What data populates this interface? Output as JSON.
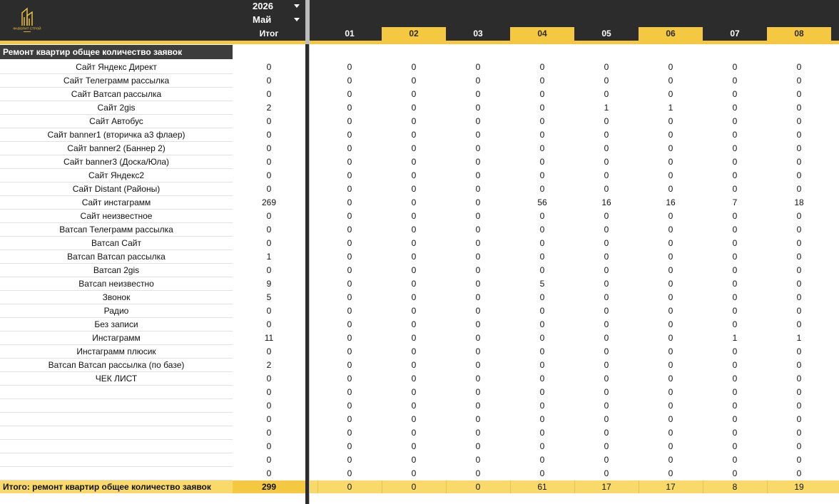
{
  "brand": {
    "logo_icon": "building-logo-icon",
    "logo_text": "ФАВОРИТ СТРОЙ",
    "accent": "#f5c842",
    "dark": "#2c2c2c"
  },
  "filters": {
    "year": "2026",
    "month": "Май"
  },
  "header": {
    "total_label": "Итог"
  },
  "days": [
    "01",
    "02",
    "03",
    "04",
    "05",
    "06",
    "07",
    "08"
  ],
  "section_title": "Ремонт квартир общее количество заявок",
  "rows": [
    {
      "label": "Сайт Яндекс Директ",
      "total": "0",
      "values": [
        "0",
        "0",
        "0",
        "0",
        "0",
        "0",
        "0",
        "0"
      ]
    },
    {
      "label": "Сайт Телеграмм рассылка",
      "total": "0",
      "values": [
        "0",
        "0",
        "0",
        "0",
        "0",
        "0",
        "0",
        "0"
      ]
    },
    {
      "label": "Сайт Ватсап рассылка",
      "total": "0",
      "values": [
        "0",
        "0",
        "0",
        "0",
        "0",
        "0",
        "0",
        "0"
      ]
    },
    {
      "label": "Сайт 2gis",
      "total": "2",
      "values": [
        "0",
        "0",
        "0",
        "0",
        "1",
        "1",
        "0",
        "0"
      ]
    },
    {
      "label": "Сайт Автобус",
      "total": "0",
      "values": [
        "0",
        "0",
        "0",
        "0",
        "0",
        "0",
        "0",
        "0"
      ]
    },
    {
      "label": "Сайт banner1 (вторичка а3 флаер)",
      "total": "0",
      "values": [
        "0",
        "0",
        "0",
        "0",
        "0",
        "0",
        "0",
        "0"
      ]
    },
    {
      "label": "Сайт banner2 (Баннер 2)",
      "total": "0",
      "values": [
        "0",
        "0",
        "0",
        "0",
        "0",
        "0",
        "0",
        "0"
      ]
    },
    {
      "label": "Сайт banner3 (Доска/Юла)",
      "total": "0",
      "values": [
        "0",
        "0",
        "0",
        "0",
        "0",
        "0",
        "0",
        "0"
      ]
    },
    {
      "label": "Сайт Яндекс2",
      "total": "0",
      "values": [
        "0",
        "0",
        "0",
        "0",
        "0",
        "0",
        "0",
        "0"
      ]
    },
    {
      "label": "Сайт Distant (Районы)",
      "total": "0",
      "values": [
        "0",
        "0",
        "0",
        "0",
        "0",
        "0",
        "0",
        "0"
      ]
    },
    {
      "label": "Сайт инстаграмм",
      "total": "269",
      "values": [
        "0",
        "0",
        "0",
        "56",
        "16",
        "16",
        "7",
        "18"
      ]
    },
    {
      "label": "Сайт неизвестное",
      "total": "0",
      "values": [
        "0",
        "0",
        "0",
        "0",
        "0",
        "0",
        "0",
        "0"
      ]
    },
    {
      "label": "Ватсап Телеграмм рассылка",
      "total": "0",
      "values": [
        "0",
        "0",
        "0",
        "0",
        "0",
        "0",
        "0",
        "0"
      ]
    },
    {
      "label": "Ватсап Сайт",
      "total": "0",
      "values": [
        "0",
        "0",
        "0",
        "0",
        "0",
        "0",
        "0",
        "0"
      ]
    },
    {
      "label": "Ватсап Ватсап рассылка",
      "total": "1",
      "values": [
        "0",
        "0",
        "0",
        "0",
        "0",
        "0",
        "0",
        "0"
      ]
    },
    {
      "label": "Ватсап 2gis",
      "total": "0",
      "values": [
        "0",
        "0",
        "0",
        "0",
        "0",
        "0",
        "0",
        "0"
      ]
    },
    {
      "label": "Ватсап неизвестно",
      "total": "9",
      "values": [
        "0",
        "0",
        "0",
        "5",
        "0",
        "0",
        "0",
        "0"
      ]
    },
    {
      "label": "Звонок",
      "total": "5",
      "values": [
        "0",
        "0",
        "0",
        "0",
        "0",
        "0",
        "0",
        "0"
      ]
    },
    {
      "label": "Радио",
      "total": "0",
      "values": [
        "0",
        "0",
        "0",
        "0",
        "0",
        "0",
        "0",
        "0"
      ]
    },
    {
      "label": "Без записи",
      "total": "0",
      "values": [
        "0",
        "0",
        "0",
        "0",
        "0",
        "0",
        "0",
        "0"
      ]
    },
    {
      "label": "Инстаграмм",
      "total": "11",
      "values": [
        "0",
        "0",
        "0",
        "0",
        "0",
        "0",
        "1",
        "1"
      ]
    },
    {
      "label": "Инстаграмм плюсик",
      "total": "0",
      "values": [
        "0",
        "0",
        "0",
        "0",
        "0",
        "0",
        "0",
        "0"
      ]
    },
    {
      "label": "Ватсап Ватсап рассылка (по базе)",
      "total": "2",
      "values": [
        "0",
        "0",
        "0",
        "0",
        "0",
        "0",
        "0",
        "0"
      ]
    },
    {
      "label": "ЧЕК ЛИСТ",
      "total": "0",
      "values": [
        "0",
        "0",
        "0",
        "0",
        "0",
        "0",
        "0",
        "0"
      ]
    },
    {
      "label": "",
      "total": "0",
      "values": [
        "0",
        "0",
        "0",
        "0",
        "0",
        "0",
        "0",
        "0"
      ]
    },
    {
      "label": "",
      "total": "0",
      "values": [
        "0",
        "0",
        "0",
        "0",
        "0",
        "0",
        "0",
        "0"
      ]
    },
    {
      "label": "",
      "total": "0",
      "values": [
        "0",
        "0",
        "0",
        "0",
        "0",
        "0",
        "0",
        "0"
      ]
    },
    {
      "label": "",
      "total": "0",
      "values": [
        "0",
        "0",
        "0",
        "0",
        "0",
        "0",
        "0",
        "0"
      ]
    },
    {
      "label": "",
      "total": "0",
      "values": [
        "0",
        "0",
        "0",
        "0",
        "0",
        "0",
        "0",
        "0"
      ]
    },
    {
      "label": "",
      "total": "0",
      "values": [
        "0",
        "0",
        "0",
        "0",
        "0",
        "0",
        "0",
        "0"
      ]
    },
    {
      "label": "",
      "total": "0",
      "values": [
        "0",
        "0",
        "0",
        "0",
        "0",
        "0",
        "0",
        "0"
      ]
    }
  ],
  "totals": {
    "label": "Итого: ремонт квартир общее количество заявок",
    "sum": "299",
    "values": [
      "0",
      "0",
      "0",
      "61",
      "17",
      "17",
      "8",
      "19"
    ]
  }
}
